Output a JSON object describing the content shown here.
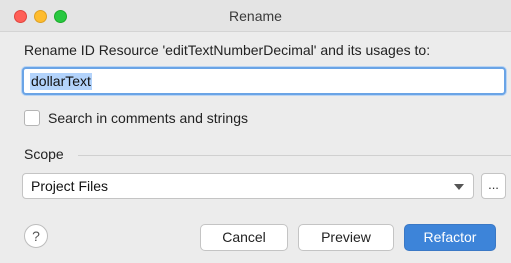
{
  "window": {
    "title": "Rename"
  },
  "dialog": {
    "prompt": "Rename ID Resource 'editTextNumberDecimal' and its usages to:",
    "new_name_value": "dollarText",
    "search_comments_label": "Search in comments and strings",
    "search_comments_checked": false,
    "scope_label": "Scope",
    "scope_selected": "Project Files",
    "ellipsis_label": "...",
    "help_label": "?"
  },
  "buttons": {
    "cancel": "Cancel",
    "preview": "Preview",
    "refactor": "Refactor"
  },
  "colors": {
    "accent": "#3d84d9",
    "focus_ring": "#6aa4e6",
    "text_selection": "#b3d3fb",
    "close": "#ff5f57",
    "minimize": "#febc2e",
    "maximize": "#28c840"
  },
  "icons": {
    "close": "close-window-icon",
    "minimize": "minimize-window-icon",
    "maximize": "maximize-window-icon",
    "dropdown": "chevron-down-icon",
    "help": "help-icon"
  }
}
